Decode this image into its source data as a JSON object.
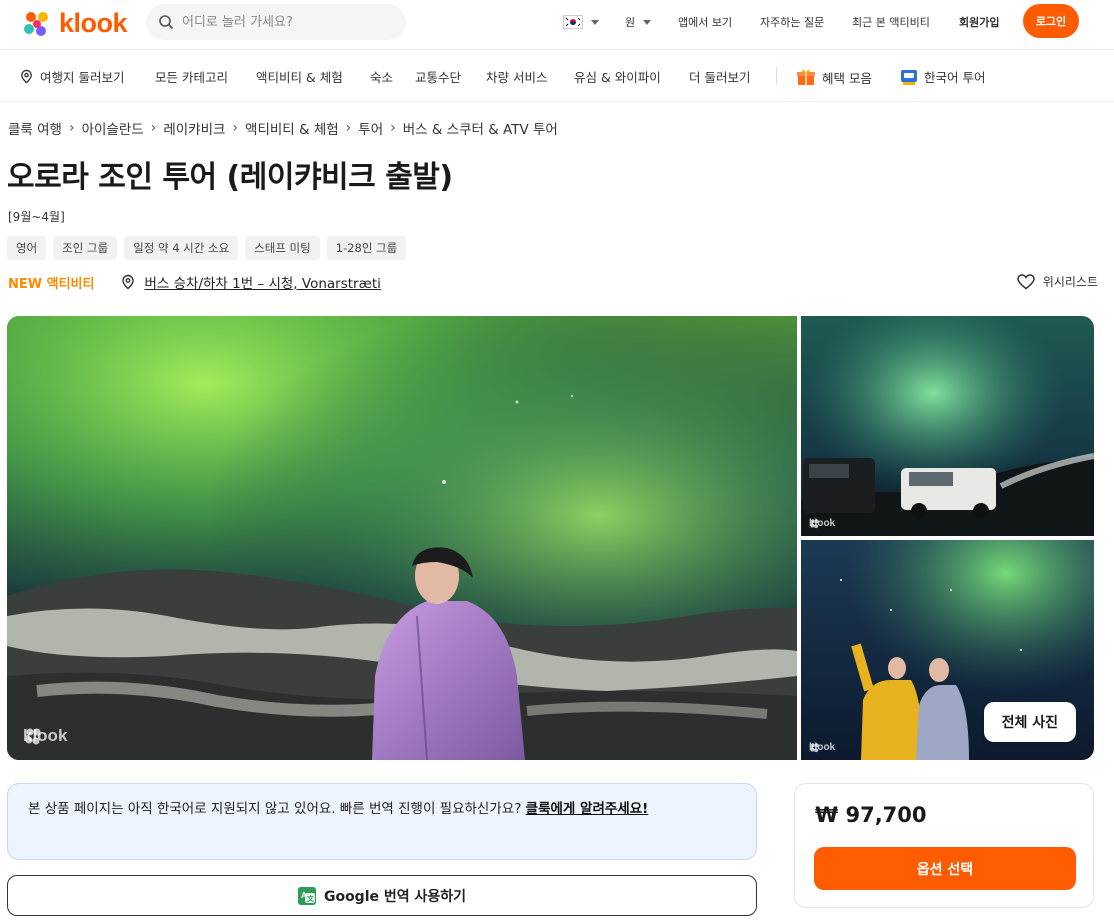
{
  "header": {
    "brand": "klook",
    "search_placeholder": "어디로 놀러 가세요?",
    "currency": "원",
    "nav": {
      "app": "앱에서 보기",
      "faq": "자주하는 질문",
      "recent": "최근 본 액티비티",
      "signup": "회원가입",
      "login": "로그인"
    },
    "accent_color": "#ff5b00"
  },
  "categories": {
    "explore": "여행지 둘러보기",
    "all": "모든 카테고리",
    "activities": "액티비티 & 체험",
    "hotels": "숙소",
    "transport": "교통수단",
    "car": "차량 서비스",
    "sim": "유심 & 와이파이",
    "more": "더 둘러보기",
    "deals": "혜택 모음",
    "korea": "한국어 투어"
  },
  "breadcrumb": [
    "클룩 여행",
    "아이슬란드",
    "레이캬비크",
    "액티비티 & 체험",
    "투어",
    "버스 & 스쿠터 & ATV 투어"
  ],
  "activity": {
    "title": "오로라 조인 투어 (레이캬비크 출발)",
    "season": "[9월~4월]",
    "tags": [
      "영어",
      "조인 그룹",
      "일정 약 4 시간  소요",
      "스태프 미팅",
      "1-28인 그룹"
    ],
    "new_label": "NEW 액티비티",
    "location": "버스 승차/하차 1번 – 시청, Vonarstræti",
    "wishlist": "위시리스트"
  },
  "gallery": {
    "watermark": "klook",
    "all_photos": "전체 사진"
  },
  "notice": {
    "text": "본 상품 페이지는 아직 한국어로 지원되지 않고 있어요. 빠른 번역 진행이 필요하신가요? ",
    "link": "클룩에게 알려주세요!",
    "google_button": "Google 번역 사용하기"
  },
  "booking": {
    "price": "₩ 97,700",
    "select_button": "옵션 선택"
  }
}
